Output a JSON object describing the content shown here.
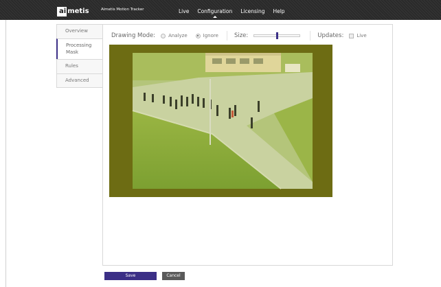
{
  "header": {
    "logo_prefix": "ai",
    "logo_suffix": "metis",
    "app_title": "Aimetis Motion Tracker",
    "nav": [
      {
        "label": "Live",
        "active": false
      },
      {
        "label": "Configuration",
        "active": true
      },
      {
        "label": "Licensing",
        "active": false
      },
      {
        "label": "Help",
        "active": false
      }
    ]
  },
  "tabs": [
    {
      "label": "Overview",
      "active": false
    },
    {
      "label": "Processing Mask",
      "active": true
    },
    {
      "label": "Rules",
      "active": false
    },
    {
      "label": "Advanced",
      "active": false
    }
  ],
  "toolbar": {
    "drawing_mode_label": "Drawing Mode:",
    "options": [
      {
        "label": "Analyze",
        "selected": false
      },
      {
        "label": "Ignore",
        "selected": true
      }
    ],
    "size_label": "Size:",
    "size_value": 0.5,
    "updates_label": "Updates:",
    "live_label": "Live",
    "live_checked": false
  },
  "actions": {
    "save_label": "Save",
    "cancel_label": "Cancel"
  },
  "colors": {
    "accent": "#3b2f86",
    "mask_overlay": "#6d6c13",
    "topbar": "#2a2a2a"
  }
}
